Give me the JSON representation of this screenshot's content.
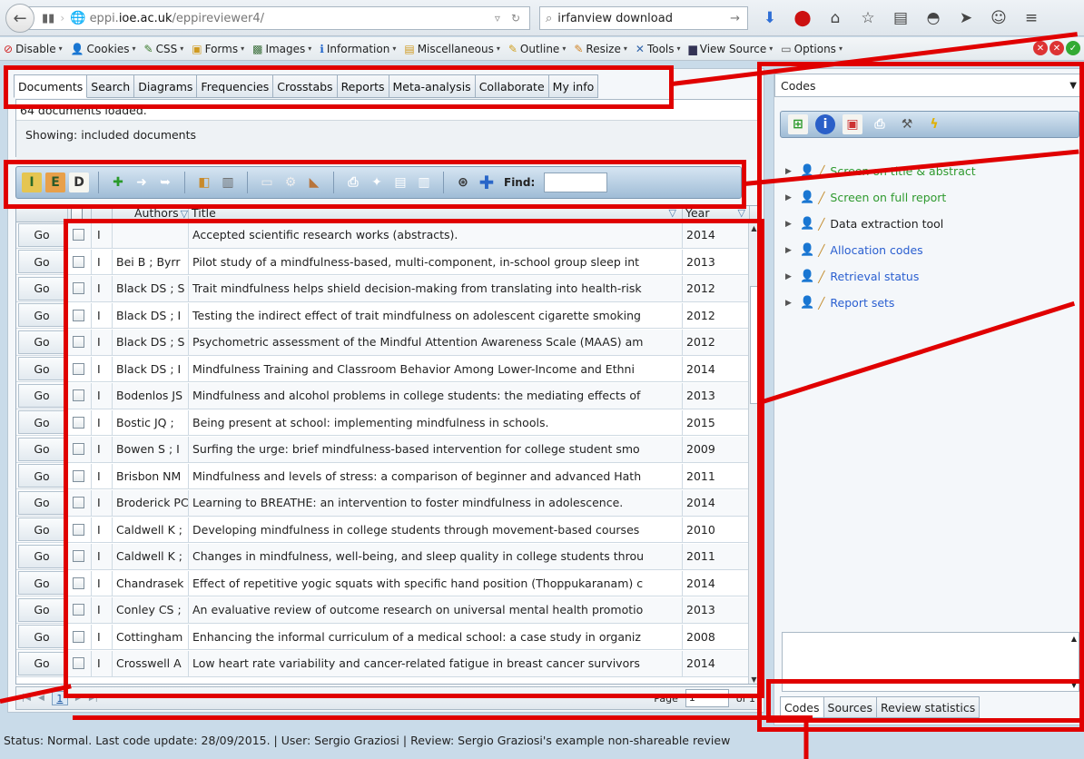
{
  "browser": {
    "url_prefix": "eppi.",
    "url_domain": "ioe.ac.uk",
    "url_path": "/eppireviewer4/",
    "search_text": "irfanview download",
    "devbar": [
      {
        "icon": "⊘",
        "label": "Disable",
        "color": "#d02020"
      },
      {
        "icon": "👤",
        "label": "Cookies",
        "color": "#222"
      },
      {
        "icon": "✎",
        "label": "CSS",
        "color": "#3a7a2a"
      },
      {
        "icon": "▣",
        "label": "Forms",
        "color": "#d09a20"
      },
      {
        "icon": "▩",
        "label": "Images",
        "color": "#3a6e3a"
      },
      {
        "icon": "ℹ",
        "label": "Information",
        "color": "#2266cc"
      },
      {
        "icon": "▤",
        "label": "Miscellaneous",
        "color": "#d09a20"
      },
      {
        "icon": "✎",
        "label": "Outline",
        "color": "#d0a020"
      },
      {
        "icon": "✎",
        "label": "Resize",
        "color": "#d08020"
      },
      {
        "icon": "✕",
        "label": "Tools",
        "color": "#3366aa"
      },
      {
        "icon": "▆",
        "label": "View Source",
        "color": "#335"
      },
      {
        "icon": "▭",
        "label": "Options",
        "color": "#555"
      }
    ]
  },
  "tabs": [
    "Documents",
    "Search",
    "Diagrams",
    "Frequencies",
    "Crosstabs",
    "Reports",
    "Meta-analysis",
    "Collaborate",
    "My info"
  ],
  "info": {
    "loaded": "64 documents loaded.",
    "showing": "Showing: included documents"
  },
  "find_label": "Find:",
  "grid": {
    "headers": {
      "authors": "Authors",
      "title": "Title",
      "year": "Year"
    },
    "go_label": "Go",
    "rows": [
      {
        "flag": "I",
        "authors": "",
        "title": "Accepted scientific research works (abstracts).",
        "year": "2014"
      },
      {
        "flag": "I",
        "authors": "Bei B ; Byrr",
        "title": "Pilot study of a mindfulness-based, multi-component, in-school group sleep int",
        "year": "2013"
      },
      {
        "flag": "I",
        "authors": "Black DS ; S",
        "title": "Trait mindfulness helps shield decision-making from translating into health-risk",
        "year": "2012"
      },
      {
        "flag": "I",
        "authors": "Black DS ; I",
        "title": "Testing the indirect effect of trait mindfulness on adolescent cigarette smoking",
        "year": "2012"
      },
      {
        "flag": "I",
        "authors": "Black DS ; S",
        "title": "Psychometric assessment of the Mindful Attention Awareness Scale (MAAS) am",
        "year": "2012"
      },
      {
        "flag": "I",
        "authors": "Black DS ; I",
        "title": "Mindfulness Training and Classroom Behavior Among Lower-Income and Ethni",
        "year": "2014"
      },
      {
        "flag": "I",
        "authors": "Bodenlos JS",
        "title": "Mindfulness and alcohol problems in college students: the mediating effects of",
        "year": "2013"
      },
      {
        "flag": "I",
        "authors": "Bostic JQ ;",
        "title": "Being present at school: implementing mindfulness in schools.",
        "year": "2015"
      },
      {
        "flag": "I",
        "authors": "Bowen S ; I",
        "title": "Surfing the urge: brief mindfulness-based intervention for college student smo",
        "year": "2009"
      },
      {
        "flag": "I",
        "authors": "Brisbon NM",
        "title": "Mindfulness and levels of stress: a comparison of beginner and advanced Hath",
        "year": "2011"
      },
      {
        "flag": "I",
        "authors": "Broderick PC",
        "title": "Learning to BREATHE: an intervention to foster mindfulness in adolescence.",
        "year": "2014"
      },
      {
        "flag": "I",
        "authors": "Caldwell K ;",
        "title": "Developing mindfulness in college students through movement-based courses",
        "year": "2010"
      },
      {
        "flag": "I",
        "authors": "Caldwell K ;",
        "title": "Changes in mindfulness, well-being, and sleep quality in college students throu",
        "year": "2011"
      },
      {
        "flag": "I",
        "authors": "Chandrasek",
        "title": "Effect of repetitive yogic squats with specific hand position (Thoppukaranam) c",
        "year": "2014"
      },
      {
        "flag": "I",
        "authors": "Conley CS ;",
        "title": "An evaluative review of outcome research on universal mental health promotio",
        "year": "2013"
      },
      {
        "flag": "I",
        "authors": "Cottingham",
        "title": "Enhancing the informal curriculum of a medical school: a case study in organiz",
        "year": "2008"
      },
      {
        "flag": "I",
        "authors": "Crosswell A",
        "title": "Low heart rate variability and cancer-related fatigue in breast cancer survivors",
        "year": "2014"
      }
    ]
  },
  "pager": {
    "current": "1",
    "page_label": "Page",
    "page_value": "1",
    "of_label": "of 1"
  },
  "codes": {
    "select_label": "Codes",
    "items": [
      {
        "label": "Screen on title & abstract",
        "color": "#2f9a2f"
      },
      {
        "label": "Screen on full report",
        "color": "#2f9a2f"
      },
      {
        "label": "Data extraction tool",
        "color": "#222222"
      },
      {
        "label": "Allocation codes",
        "color": "#2a5fd0"
      },
      {
        "label": "Retrieval status",
        "color": "#2a5fd0"
      },
      {
        "label": "Report sets",
        "color": "#2a5fd0"
      }
    ],
    "bottom_tabs": [
      "Codes",
      "Sources",
      "Review statistics"
    ]
  },
  "status": "Status: Normal. Last code update: 28/09/2015. | User: Sergio Graziosi | Review: Sergio Graziosi's example non-shareable review"
}
